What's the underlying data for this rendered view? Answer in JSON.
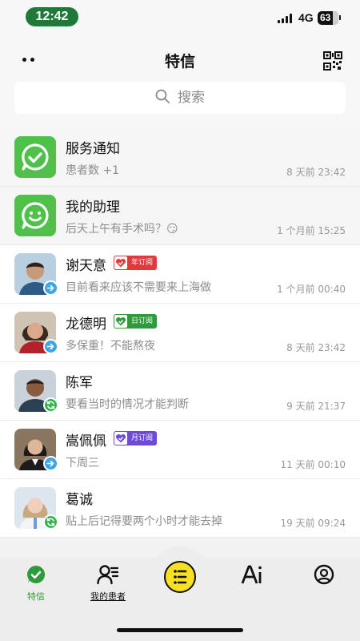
{
  "status_bar": {
    "time": "12:42",
    "network": "4G",
    "battery": "63"
  },
  "header": {
    "title": "特信",
    "search_placeholder": "搜索"
  },
  "chats": [
    {
      "name": "服务通知",
      "preview": "患者数 +1",
      "time": "8 天前 23:42",
      "avatar": "check-icon",
      "pinned": true
    },
    {
      "name": "我的助理",
      "preview": "后天上午有手术吗？😏",
      "time": "1 个月前 15:25",
      "avatar": "smile-icon",
      "pinned": true
    },
    {
      "name": "谢天意",
      "tag": "年订阅",
      "tag_color": "#e23a3a",
      "preview": "目前看来应该不需要来上海做",
      "time": "1 个月前 00:40",
      "badge": "arrow-icon"
    },
    {
      "name": "龙德明",
      "tag": "日订阅",
      "tag_color": "#2e9a3c",
      "preview": "多保重！不能熬夜",
      "time": "8 天前 23:42",
      "badge": "arrow-icon"
    },
    {
      "name": "陈军",
      "preview": "要看当时的情况才能判断",
      "time": "9 天前 21:37",
      "badge": "sync-icon"
    },
    {
      "name": "嵩佩佩",
      "tag": "月订阅",
      "tag_color": "#6d4ad8",
      "preview": "下周三",
      "time": "11 天前 00:10",
      "badge": "arrow-icon"
    },
    {
      "name": "葛诚",
      "preview": "贴上后记得要两个小时才能去掉",
      "time": "19 天前 09:24",
      "badge": "sync-icon"
    }
  ],
  "nav": {
    "items": [
      {
        "label": "特信",
        "icon": "chat-check-icon",
        "active": true,
        "color": "#2e9a3c"
      },
      {
        "label": "我的患者",
        "icon": "patients-icon",
        "active": false
      },
      {
        "label": "",
        "icon": "menu-list-icon",
        "active": false
      },
      {
        "label": "",
        "icon": "ai-icon",
        "active": false
      },
      {
        "label": "",
        "icon": "profile-icon",
        "active": false
      }
    ]
  }
}
